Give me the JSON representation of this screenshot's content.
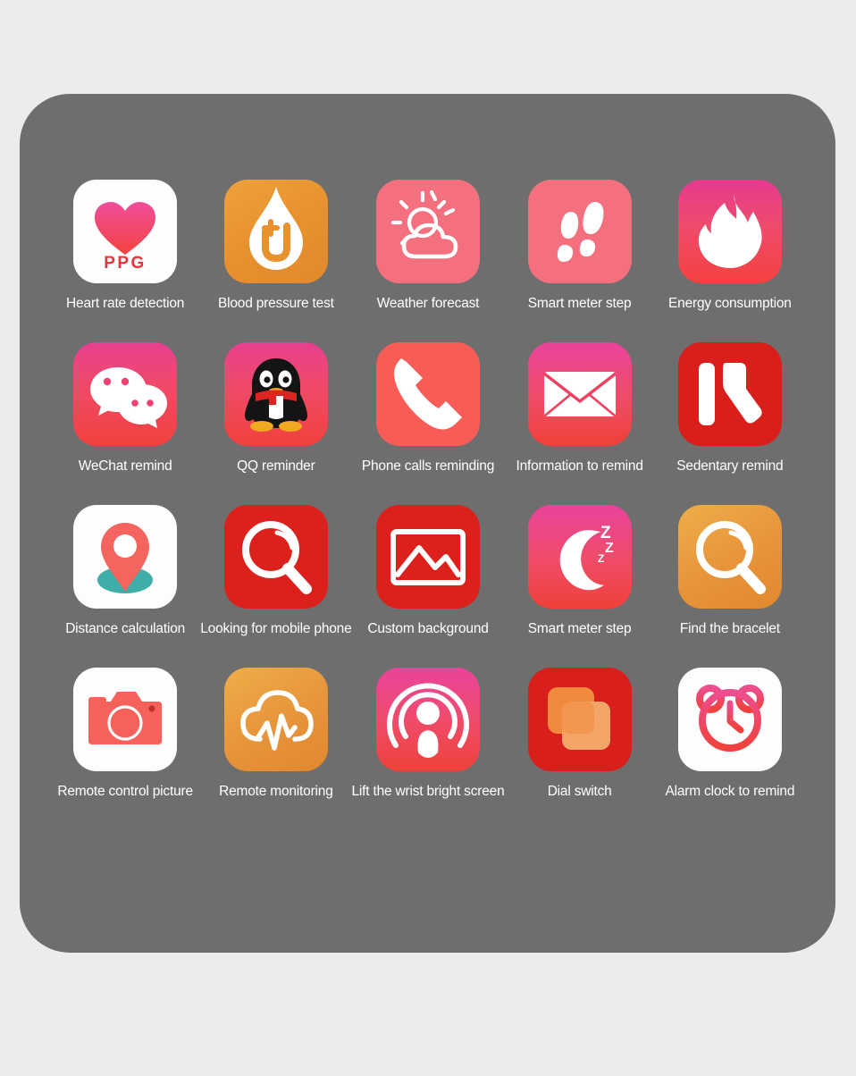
{
  "panel": {
    "background_color": "#6e6e6e",
    "page_background_color": "#ececec",
    "label_color": "#ffffff"
  },
  "apps": [
    {
      "label": "Heart rate detection",
      "icon": "heart-ppg-icon",
      "tile_class": "bg-white",
      "badge_text": "PPG"
    },
    {
      "label": "Blood pressure test",
      "icon": "blood-drop-plus-icon",
      "tile_class": "bg-orange"
    },
    {
      "label": "Weather forecast",
      "icon": "sun-cloud-icon",
      "tile_class": "bg-pink-flat"
    },
    {
      "label": "Smart meter step",
      "icon": "footprints-icon",
      "tile_class": "bg-pink-flat"
    },
    {
      "label": "Energy consumption",
      "icon": "flame-icon",
      "tile_class": "bg-magred"
    },
    {
      "label": "WeChat remind",
      "icon": "wechat-bubbles-icon",
      "tile_class": "bg-magred2"
    },
    {
      "label": "QQ reminder",
      "icon": "qq-penguin-icon",
      "tile_class": "bg-magred2"
    },
    {
      "label": "Phone calls reminding",
      "icon": "phone-handset-icon",
      "tile_class": "bg-coral"
    },
    {
      "label": "Information to remind",
      "icon": "envelope-icon",
      "tile_class": "bg-pinkred"
    },
    {
      "label": "Sedentary remind",
      "icon": "sitting-person-icon",
      "tile_class": "bg-red"
    },
    {
      "label": "Distance calculation",
      "icon": "map-pin-icon",
      "tile_class": "bg-white"
    },
    {
      "label": "Looking for mobile phone",
      "icon": "magnifier-icon",
      "tile_class": "bg-red2"
    },
    {
      "label": "Custom background",
      "icon": "picture-icon",
      "tile_class": "bg-red2"
    },
    {
      "label": "Smart meter step",
      "icon": "sleep-moon-zzz-icon",
      "tile_class": "bg-pinkred"
    },
    {
      "label": "Find the bracelet",
      "icon": "magnifier-icon",
      "tile_class": "bg-orange2"
    },
    {
      "label": "Remote control picture",
      "icon": "camera-icon",
      "tile_class": "bg-white"
    },
    {
      "label": "Remote monitoring",
      "icon": "cloud-pulse-icon",
      "tile_class": "bg-orange2"
    },
    {
      "label": "Lift the wrist bright screen",
      "icon": "podcast-waves-icon",
      "tile_class": "bg-pinkred"
    },
    {
      "label": "Dial switch",
      "icon": "layered-squares-icon",
      "tile_class": "bg-red"
    },
    {
      "label": "Alarm clock to remind",
      "icon": "alarm-clock-icon",
      "tile_class": "bg-white"
    }
  ]
}
